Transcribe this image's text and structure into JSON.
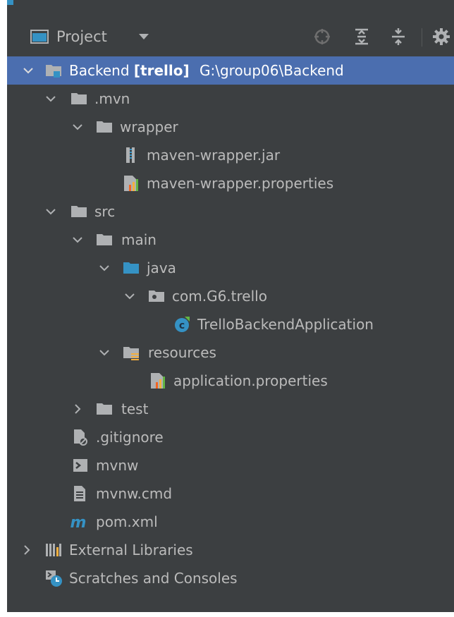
{
  "panel": {
    "title": "Project",
    "icons": [
      "locate-icon",
      "expand-all-icon",
      "collapse-all-icon",
      "gear-icon"
    ]
  },
  "tree": {
    "root": {
      "name": "Backend",
      "module": "[trello]",
      "path": "G:\\group06\\Backend"
    },
    "mvn": ".mvn",
    "wrapper": "wrapper",
    "wrapper_jar": "maven-wrapper.jar",
    "wrapper_props": "maven-wrapper.properties",
    "src": "src",
    "main": "main",
    "java": "java",
    "package": "com.G6.trello",
    "app_class": "TrelloBackendApplication",
    "resources": "resources",
    "app_props": "application.properties",
    "test": "test",
    "gitignore": ".gitignore",
    "mvnw": "mvnw",
    "mvnw_cmd": "mvnw.cmd",
    "pom": "pom.xml",
    "ext_libs": "External Libraries",
    "scratches": "Scratches and Consoles"
  },
  "colors": {
    "panel_bg": "#3c3f41",
    "selection": "#4b6eaf",
    "text": "#bbbbbb",
    "folder": "#afb1b3",
    "source_folder": "#3592c4"
  }
}
